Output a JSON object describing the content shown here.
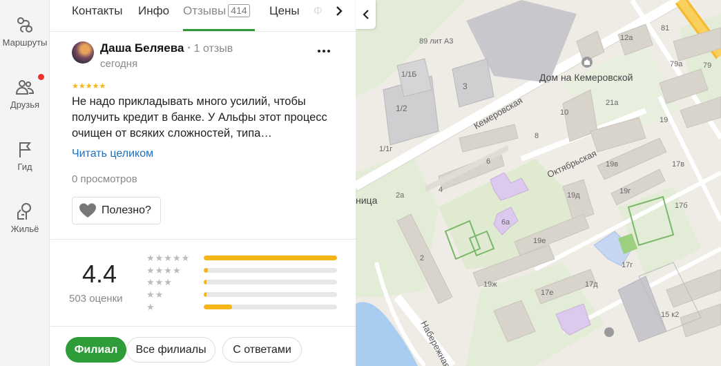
{
  "rail": {
    "items": [
      {
        "label": "Маршруты",
        "icon": "routes-icon"
      },
      {
        "label": "Друзья",
        "icon": "friends-icon"
      },
      {
        "label": "Гид",
        "icon": "flag-icon"
      },
      {
        "label": "Жильё",
        "icon": "housing-icon"
      }
    ]
  },
  "tabs": {
    "items": [
      "Контакты",
      "Инфо",
      "Отзывы",
      "Цены",
      "Ф"
    ],
    "active": "Отзывы",
    "reviews_count": "414"
  },
  "review": {
    "author": "Даша Беляева",
    "author_reviews": "1 отзыв",
    "date": "сегодня",
    "stars": "★★★★★",
    "text": "Не надо прикладывать много усилий, чтобы получить кредит в банке. У Альфы этот процесс очищен от всяких сложностей, типа…",
    "read_more": "Читать целиком",
    "views": "0 просмотров",
    "useful_label": "Полезно?"
  },
  "rating": {
    "value": "4.4",
    "count_label": "503 оценки",
    "distribution": [
      {
        "stars": "★★★★★",
        "fraction": 1.0
      },
      {
        "stars": "★★★★",
        "fraction": 0.03
      },
      {
        "stars": "★★★",
        "fraction": 0.02
      },
      {
        "stars": "★★",
        "fraction": 0.01
      },
      {
        "stars": "★",
        "fraction": 0.21
      }
    ]
  },
  "filters": {
    "items": [
      "Филиал",
      "Все филиалы",
      "С ответами"
    ],
    "active": "Филиал"
  },
  "map": {
    "labels": [
      "89 лит А3",
      "1/1Б",
      "3",
      "1/2",
      "1/1г",
      "2а",
      "4",
      "2",
      "6",
      "6а",
      "8",
      "10",
      "21а",
      "19",
      "19в",
      "17в",
      "19д",
      "19г",
      "17б",
      "19е",
      "17г",
      "19ж",
      "17е",
      "17д",
      "15 к2",
      "81",
      "12а",
      "79а",
      "79"
    ],
    "poi": "Дом на Кемеровской",
    "poi_partial": "ница",
    "streets": [
      "Кемеровская",
      "Октябрьская",
      "Набережная"
    ]
  },
  "colors": {
    "accent_green": "#2e9c38",
    "star_yellow": "#f5b517",
    "link_blue": "#1a6fbf",
    "notification_red": "#f0302a",
    "river": "#a9cdf0"
  }
}
